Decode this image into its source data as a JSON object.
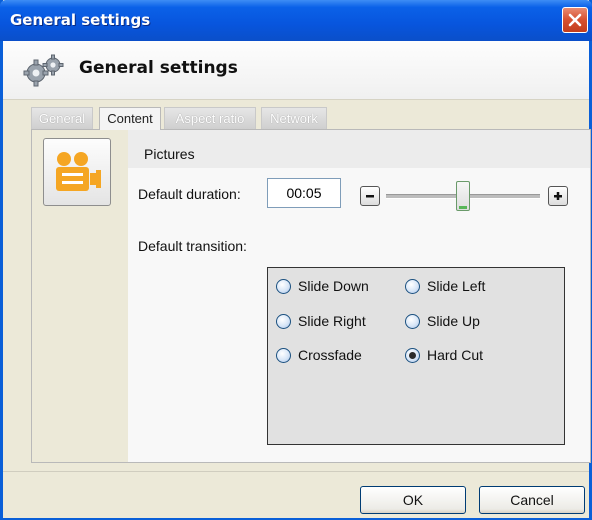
{
  "window": {
    "title": "General settings"
  },
  "header": {
    "title": "General settings"
  },
  "tabs": [
    {
      "label": "General"
    },
    {
      "label": "Content"
    },
    {
      "label": "Aspect ratio"
    },
    {
      "label": "Network"
    }
  ],
  "active_tab": "Content",
  "section": {
    "title": "Pictures"
  },
  "duration": {
    "label": "Default duration:",
    "value": "00:05",
    "slider_fraction": 0.5
  },
  "transition": {
    "label": "Default transition:",
    "options": [
      {
        "label": "Slide Down",
        "checked": false
      },
      {
        "label": "Slide Left",
        "checked": false
      },
      {
        "label": "Slide Right",
        "checked": false
      },
      {
        "label": "Slide Up",
        "checked": false
      },
      {
        "label": "Crossfade",
        "checked": false
      },
      {
        "label": "Hard Cut",
        "checked": true
      }
    ]
  },
  "footer": {
    "ok_label": "OK",
    "cancel_label": "Cancel"
  },
  "icons": {
    "close": "close-icon",
    "gear": "gear-icon",
    "content": "video-camera-icon",
    "minus": "minus-icon",
    "plus": "plus-icon"
  },
  "colors": {
    "titlebar": "#0a61e8",
    "close_button": "#d6502f",
    "content_icon": "#f5a623",
    "radio_box": "#e1e1e1",
    "slider_thumb_accent": "#58b658"
  }
}
